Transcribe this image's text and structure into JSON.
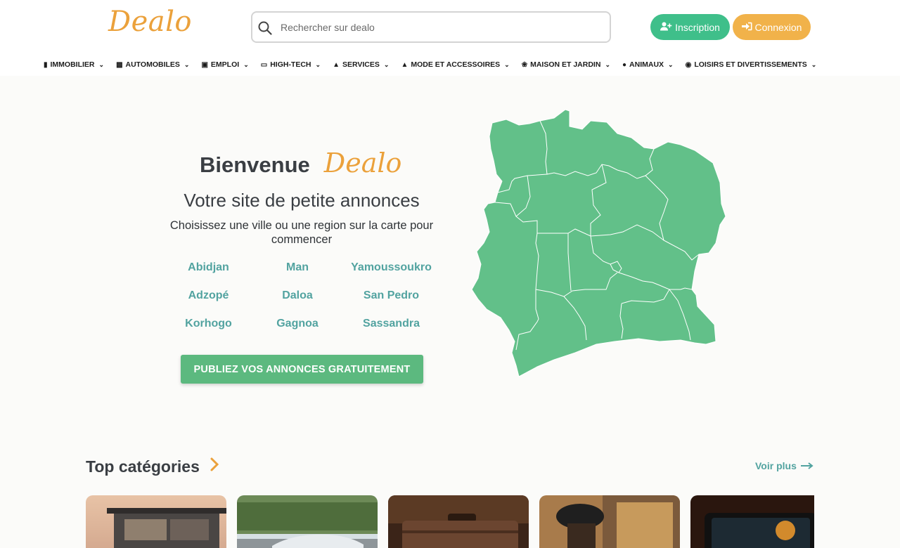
{
  "header": {
    "logo": "Dealo",
    "search_placeholder": "Rechercher sur dealo",
    "signup_label": "Inscription",
    "login_label": "Connexion"
  },
  "nav": {
    "items": [
      {
        "label": "IMMOBILIER",
        "icon": "building-icon"
      },
      {
        "label": "AUTOMOBILES",
        "icon": "car-icon"
      },
      {
        "label": "EMPLOI",
        "icon": "briefcase-icon"
      },
      {
        "label": "HIGH-TECH",
        "icon": "laptop-icon"
      },
      {
        "label": "SERVICES",
        "icon": "service-bell-icon"
      },
      {
        "label": "MODE ET ACCESSOIRES",
        "icon": "shirt-icon"
      },
      {
        "label": "MAISON ET JARDIN",
        "icon": "seedling-icon"
      },
      {
        "label": "ANIMAUX",
        "icon": "paw-icon"
      },
      {
        "label": "LOISIRS ET DIVERTISSEMENTS",
        "icon": "ball-icon"
      }
    ]
  },
  "hero": {
    "welcome": "Bienvenue",
    "brand": "Dealo",
    "subtitle": "Votre site de petite annonces",
    "instruction": "Choisissez une ville ou une region sur la carte pour commencer",
    "cities": [
      "Abidjan",
      "Man",
      "Yamoussoukro",
      "Adzopé",
      "Daloa",
      "San Pedro",
      "Korhogo",
      "Gagnoa",
      "Sassandra"
    ],
    "publish_label": "PUBLIEZ VOS ANNONCES GRATUITEMENT"
  },
  "categories": {
    "title": "Top catégories",
    "see_more": "Voir plus"
  },
  "colors": {
    "brand_orange": "#eba13b",
    "signup_green": "#3fbf8a",
    "login_orange": "#f1b24a",
    "map_green": "#62c089",
    "city_teal": "#52a3a0",
    "publish_green": "#5cb97f"
  }
}
